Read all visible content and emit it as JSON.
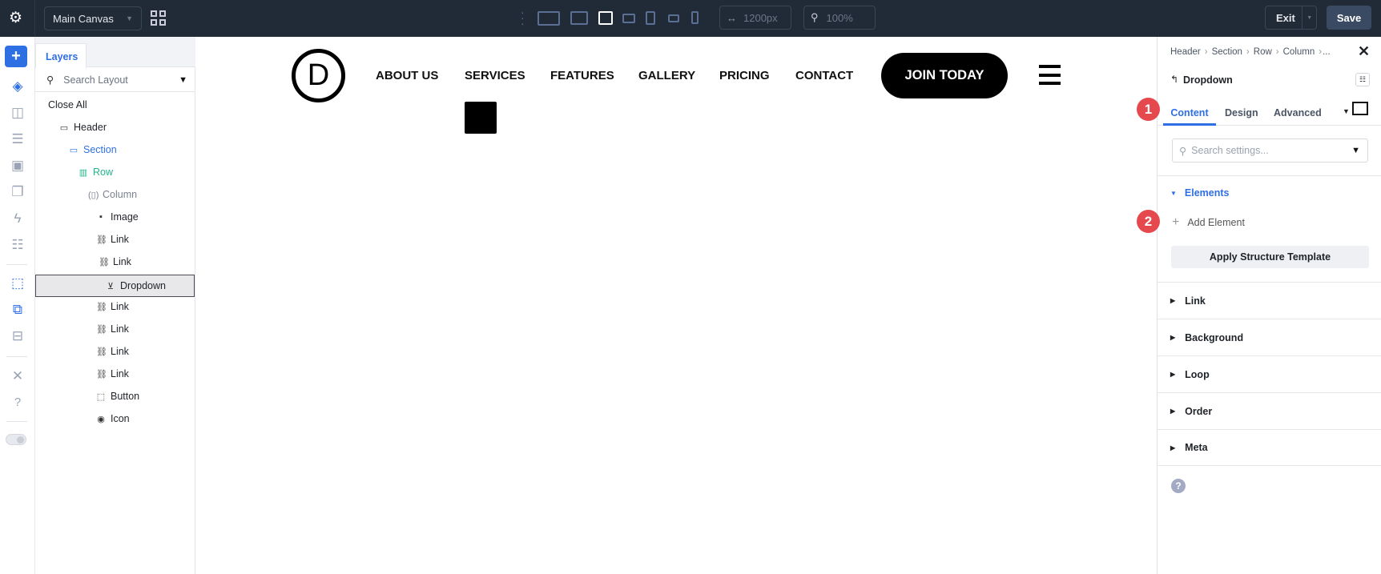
{
  "topbar": {
    "canvas_select": "Main Canvas",
    "width_value": "1200px",
    "zoom_value": "100%",
    "exit_label": "Exit",
    "save_label": "Save"
  },
  "layers": {
    "tab": "Layers",
    "search_placeholder": "Search Layout",
    "close_all": "Close All",
    "items": [
      {
        "label": "Header"
      },
      {
        "label": "Section"
      },
      {
        "label": "Row"
      },
      {
        "label": "Column"
      },
      {
        "label": "Image"
      },
      {
        "label": "Link"
      },
      {
        "label": "Link"
      },
      {
        "label": "Dropdown"
      },
      {
        "label": "Link"
      },
      {
        "label": "Link"
      },
      {
        "label": "Link"
      },
      {
        "label": "Link"
      },
      {
        "label": "Button"
      },
      {
        "label": "Icon"
      }
    ]
  },
  "canvas": {
    "logo_letter": "D",
    "nav": [
      "ABOUT US",
      "SERVICES",
      "FEATURES",
      "GALLERY",
      "PRICING",
      "CONTACT"
    ],
    "cta": "JOIN TODAY"
  },
  "panel": {
    "breadcrumb": [
      "Header",
      "Section",
      "Row",
      "Column",
      "..."
    ],
    "module_title": "Dropdown",
    "tabs": [
      "Content",
      "Design",
      "Advanced"
    ],
    "search_placeholder": "Search settings...",
    "elements_label": "Elements",
    "add_element": "Add Element",
    "apply_template": "Apply Structure Template",
    "sections": [
      "Link",
      "Background",
      "Loop",
      "Order",
      "Meta"
    ]
  },
  "badges": [
    "1",
    "2"
  ],
  "colors": {
    "accent": "#2f6fe4",
    "topbar": "#212a37",
    "badge": "#e5484d"
  }
}
